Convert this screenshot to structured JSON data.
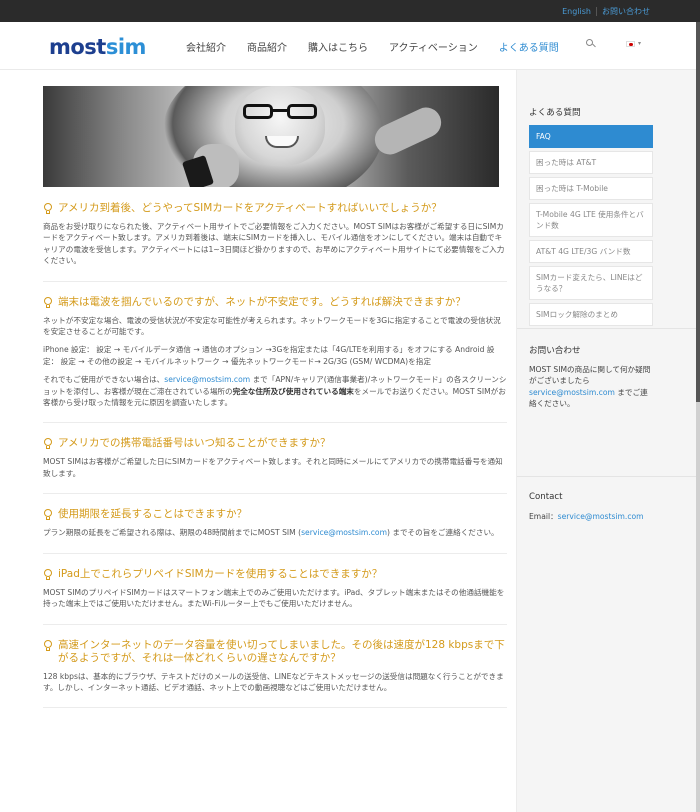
{
  "topbar": {
    "english": "English",
    "contact": "お問い合わせ"
  },
  "logo": {
    "part1": "most",
    "part2": "sim"
  },
  "nav": {
    "items": [
      "会社紹介",
      "商品紹介",
      "購入はこちら",
      "アクティベーション",
      "よくある質問"
    ],
    "active_index": 4,
    "search_icon": "search-icon",
    "language_flag": "japan-flag-icon"
  },
  "hero": {
    "description_icon": "woman-with-phone-photo"
  },
  "faq": [
    {
      "question": "アメリカ到着後、どうやってSIMカードをアクティベートすればいいでしょうか？",
      "answer": [
        "商品をお受け取りになられた後、アクティベート用サイトでご必要情報をご入力ください。MOST SIMはお客様がご希望する日にSIMカードをアクティベート致します。アメリカ到着後は、端末にSIMカードを挿入し、モバイル通信をオンにしてください。端末は自動でキャリアの電波を受信します。アクティベートには1~3日間ほど掛かりますので、お早めにアクティベート用サイトにて必要情報をご入力ください。"
      ]
    },
    {
      "question": "端末は電波を掴んでいるのですが、ネットが不安定です。どうすれば解決できますか？",
      "answer": [
        "ネットが不安定な場合、電波の受信状況が不安定な可能性が考えられます。ネットワークモードを3Gに指定することで電波の受信状況を安定させることが可能です。",
        "iPhone 設定： 設定 → モバイルデータ通信 → 通信のオプション →3Gを指定または「4G/LTEを利用する」をオフにする Android 設定： 設定 → その他の設定 → モバイルネットワーク → 優先ネットワークモード→ 2G/3G (GSM/ WCDMA)を指定"
      ],
      "answer3": {
        "pre": "それでもご使用ができない場合は、",
        "email": "service@mostsim.com",
        "mid": " まで「APN/キャリア(通信事業者)/ネットワークモード」の各スクリーンショットを添付し、お客様が現在ご滞在されている場所の",
        "bold": "完全な住所及び使用されている端末",
        "post": "をメールでお送りください。MOST SIMがお客様から受け取った情報を元に原因を調査いたします。"
      }
    },
    {
      "question": "アメリカでの携帯電話番号はいつ知ることができますか？",
      "answer": [
        "MOST SIMはお客様がご希望した日にSIMカードをアクティベート致します。それと同時にメールにてアメリカでの携帯電話番号を通知致します。"
      ]
    },
    {
      "question": "使用期限を延長することはできますか？",
      "answer5": {
        "pre": "プラン期限の延長をご希望される際は、期限の48時間前までにMOST SIM (",
        "email": "service@mostsim.com",
        "post": ") までその旨をご連絡ください。"
      }
    },
    {
      "question": "iPad上でこれらプリペイドSIMカードを使用することはできますか？",
      "answer": [
        "MOST SIMのプリペイドSIMカードはスマートフォン端末上でのみご使用いただけます。iPad、タブレット端末またはその他通話機能を持った端末上ではご使用いただけません。またWi-Fiルーター上でもご使用いただけません。"
      ]
    },
    {
      "question": "高速インターネットのデータ容量を使い切ってしまいました。その後は速度が128 kbpsまで下がるようですが、それは一体どれくらいの遅さなんですか？",
      "answer": [
        "128 kbpsは、基本的にブラウザ、テキストだけのメールの送受信、LINEなどテキストメッセージの送受信は問題なく行うことができます。しかし、インターネット通話、ビデオ通話、ネット上での動画視聴などはご使用いただけません。"
      ]
    }
  ],
  "sidebar": {
    "faq_title": "よくある質問",
    "menu": [
      "FAQ",
      "困った時は AT&T",
      "困った時は T-Mobile",
      "T-Mobile 4G LTE 使用条件とバンド数",
      "AT&T 4G LTE/3G バンド数",
      "SIMカード変えたら、LINEはどうなる？",
      "SIMロック解除のまとめ"
    ],
    "menu_active_index": 0,
    "contact_title": "お問い合わせ",
    "contact_text_pre": "MOST SIMの商品に関して何か疑問がございましたら",
    "contact_email": "service@mostsim.com",
    "contact_text_post": " までご連絡ください。",
    "contact2_title": "Contact",
    "contact2_label": "Email：",
    "contact2_email": "service@mostsim.com"
  },
  "colors": {
    "accent": "#2e8bd1",
    "question": "#d49a1a",
    "topbar": "#2b2b2b",
    "logo": "#1d3f8f"
  }
}
